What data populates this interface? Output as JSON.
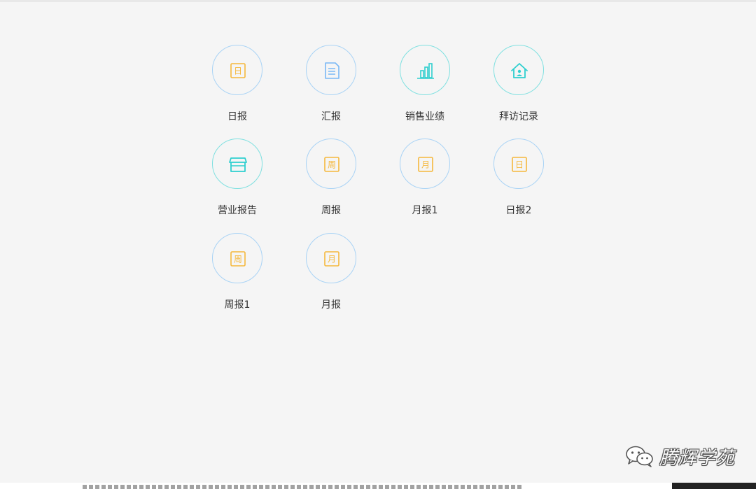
{
  "apps": [
    {
      "label": "日报",
      "icon": "calendar-day-icon",
      "glyph": "日",
      "color": "#f5b83d",
      "ring": "#a9d3f5"
    },
    {
      "label": "汇报",
      "icon": "document-icon",
      "glyph": "",
      "color": "#7ab8f5",
      "ring": "#a9d3f5"
    },
    {
      "label": "销售业绩",
      "icon": "bar-chart-icon",
      "glyph": "",
      "color": "#2ecfcf",
      "ring": "#7fe0e0"
    },
    {
      "label": "拜访记录",
      "icon": "house-person-icon",
      "glyph": "",
      "color": "#2ecfcf",
      "ring": "#7fe0e0"
    },
    {
      "label": "营业报告",
      "icon": "store-icon",
      "glyph": "",
      "color": "#2ecfcf",
      "ring": "#7fe0e0"
    },
    {
      "label": "周报",
      "icon": "calendar-week-icon",
      "glyph": "周",
      "color": "#f5b83d",
      "ring": "#a9d3f5"
    },
    {
      "label": "月报1",
      "icon": "calendar-month-icon",
      "glyph": "月",
      "color": "#f5b83d",
      "ring": "#a9d3f5"
    },
    {
      "label": "日报2",
      "icon": "calendar-day-icon",
      "glyph": "日",
      "color": "#f5b83d",
      "ring": "#a9d3f5"
    },
    {
      "label": "周报1",
      "icon": "calendar-week-icon",
      "glyph": "周",
      "color": "#f5b83d",
      "ring": "#a9d3f5"
    },
    {
      "label": "月报",
      "icon": "calendar-month-icon",
      "glyph": "月",
      "color": "#f5b83d",
      "ring": "#a9d3f5"
    }
  ],
  "watermark": {
    "text": "腾辉学苑",
    "icon": "wechat-icon"
  },
  "colors": {
    "background": "#f5f5f5",
    "ring_blue": "#a9d3f5",
    "ring_teal": "#7fe0e0",
    "accent_orange": "#f5b83d",
    "accent_teal": "#2ecfcf",
    "accent_blue": "#7ab8f5"
  }
}
